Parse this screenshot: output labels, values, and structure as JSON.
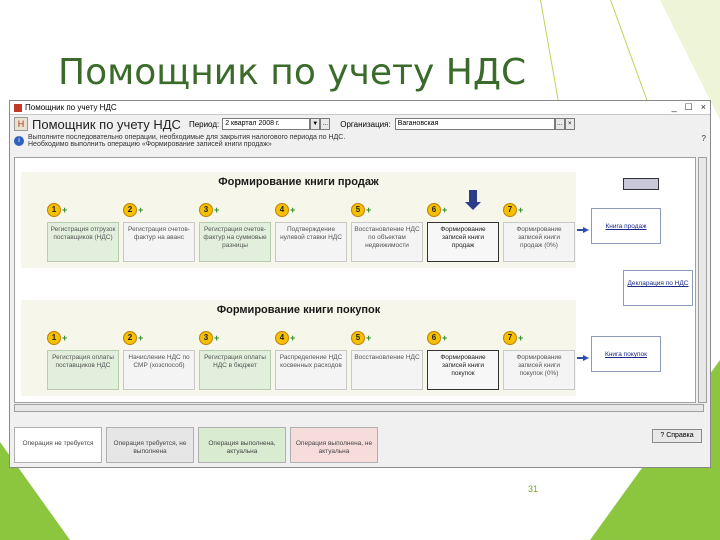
{
  "slide": {
    "title": "Помощник по учету НДС",
    "page_number": "31"
  },
  "window": {
    "title": "Помощник по учету НДС",
    "controls": [
      "_",
      "☐",
      "×"
    ],
    "toolbar": {
      "app_title": "Помощник по учету НДС",
      "period_label": "Период:",
      "period_value": "2 квартал 2008 г.",
      "org_label": "Организация:",
      "org_value": "Вагановская"
    },
    "info_lines": [
      "Выполните последовательно операции, необходимые для закрытия налогового периода по НДС.",
      "Необходимо выполнить операцию «Формирование записей книги продаж»"
    ],
    "info_help": "?"
  },
  "sales": {
    "title": "Формирование книги продаж",
    "steps": [
      {
        "num": "1",
        "text": "Регистрация отгрузок поставщиков (НДС)",
        "status": "done"
      },
      {
        "num": "2",
        "text": "Регистрация счетов-фактур на аванс",
        "status": "pending"
      },
      {
        "num": "3",
        "text": "Регистрация счетов-фактур на суммовые разницы",
        "status": "done"
      },
      {
        "num": "4",
        "text": "Подтверждение нулевой ставки НДС",
        "status": "pending"
      },
      {
        "num": "5",
        "text": "Восстановление НДС по объектам недвижимости",
        "status": "pending"
      },
      {
        "num": "6",
        "text": "Формирование записей книги продаж",
        "status": "active"
      },
      {
        "num": "7",
        "text": "Формирование записей книги продаж (0%)",
        "status": "pending"
      }
    ],
    "link": "Книга продаж"
  },
  "purchases": {
    "title": "Формирование книги покупок",
    "steps": [
      {
        "num": "1",
        "text": "Регистрация оплаты поставщиков НДС",
        "status": "done"
      },
      {
        "num": "2",
        "text": "Начисление НДС по СМР (хозспособ)",
        "status": "pending"
      },
      {
        "num": "3",
        "text": "Регистрация оплаты НДС в бюджет",
        "status": "done"
      },
      {
        "num": "4",
        "text": "Распределение НДС косвенных расходов",
        "status": "pending"
      },
      {
        "num": "5",
        "text": "Восстановление НДС",
        "status": "pending"
      },
      {
        "num": "6",
        "text": "Формирование записей книги покупок",
        "status": "active"
      },
      {
        "num": "7",
        "text": "Формирование записей книги покупок (0%)",
        "status": "pending"
      }
    ],
    "link": "Книга покупок"
  },
  "declaration_link": "Декларация по НДС",
  "legend": [
    {
      "text": "Операция не требуется",
      "color": "#ffffff"
    },
    {
      "text": "Операция требуется, не выполнена",
      "color": "#e6e6e6"
    },
    {
      "text": "Операция выполнена, актуальна",
      "color": "#d9ecd2"
    },
    {
      "text": "Операция выполнена, не актуальна",
      "color": "#f7dcdc"
    }
  ],
  "help_button": "Справка"
}
